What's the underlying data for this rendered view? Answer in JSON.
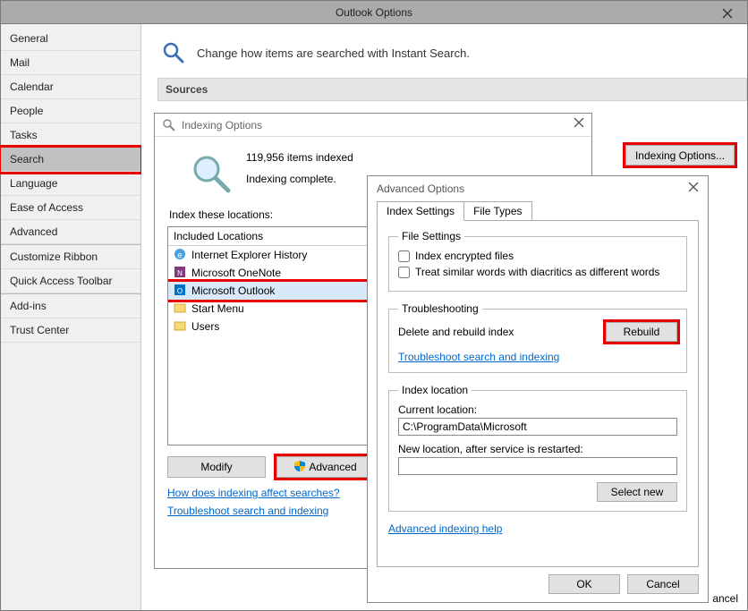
{
  "window": {
    "title": "Outlook Options"
  },
  "sidebar": {
    "items": [
      {
        "label": "General"
      },
      {
        "label": "Mail"
      },
      {
        "label": "Calendar"
      },
      {
        "label": "People"
      },
      {
        "label": "Tasks"
      },
      {
        "label": "Search"
      },
      {
        "label": "Language"
      },
      {
        "label": "Ease of Access"
      },
      {
        "label": "Advanced"
      },
      {
        "label": "Customize Ribbon"
      },
      {
        "label": "Quick Access Toolbar"
      },
      {
        "label": "Add-ins"
      },
      {
        "label": "Trust Center"
      }
    ],
    "selected_index": 5
  },
  "header": {
    "text": "Change how items are searched with Instant Search."
  },
  "section": {
    "sources": "Sources"
  },
  "indexing_button": "Indexing Options...",
  "indexing_dialog": {
    "title": "Indexing Options",
    "count": "119,956 items indexed",
    "status": "Indexing complete.",
    "locations_label": "Index these locations:",
    "list_header": "Included Locations",
    "items": [
      "Internet Explorer History",
      "Microsoft OneNote",
      "Microsoft Outlook",
      "Start Menu",
      "Users"
    ],
    "selected_index": 2,
    "modify_btn": "Modify",
    "advanced_btn": "Advanced",
    "link1": "How does indexing affect searches?",
    "link2": "Troubleshoot search and indexing"
  },
  "advanced_dialog": {
    "title": "Advanced Options",
    "tabs": [
      "Index Settings",
      "File Types"
    ],
    "active_tab": 0,
    "file_settings": {
      "legend": "File Settings",
      "chk1": "Index encrypted files",
      "chk2": "Treat similar words with diacritics as different words"
    },
    "troubleshooting": {
      "legend": "Troubleshooting",
      "label": "Delete and rebuild index",
      "rebuild_btn": "Rebuild",
      "link": "Troubleshoot search and indexing"
    },
    "index_location": {
      "legend": "Index location",
      "curr_label": "Current location:",
      "curr_value": "C:\\ProgramData\\Microsoft",
      "new_label": "New location, after service is restarted:",
      "new_value": "",
      "select_btn": "Select new"
    },
    "help_link": "Advanced indexing help",
    "ok": "OK",
    "cancel": "Cancel"
  },
  "bg_cancel": "ancel"
}
